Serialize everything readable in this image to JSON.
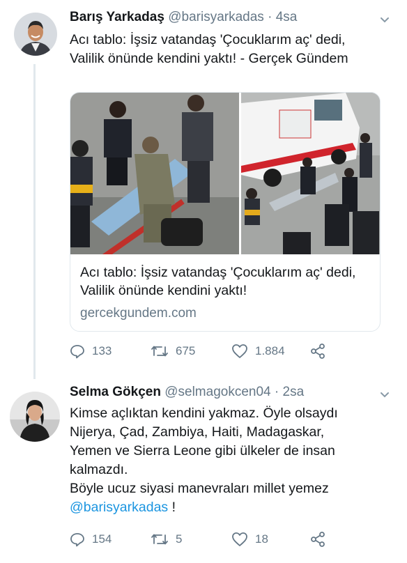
{
  "tweet1": {
    "name": "Barış Yarkadaş",
    "handle": "@barisyarkadas",
    "separator": "·",
    "time": "4sa",
    "text": "Acı tablo: İşsiz vatandaş 'Çocuklarım aç' dedi, Valilik önünde kendini yaktı!   - Gerçek Gündem",
    "card": {
      "title": "Acı tablo: İşsiz vatandaş 'Çocuklarım aç' dedi, Valilik önünde kendini yaktı!",
      "domain": "gercekgundem.com"
    },
    "actions": {
      "replies": "133",
      "retweets": "675",
      "likes": "1.884"
    }
  },
  "tweet2": {
    "name": "Selma Gökçen",
    "handle": "@selmagokcen04",
    "separator": "·",
    "time": "2sa",
    "text_lines": [
      "Kimse açlıktan kendini yakmaz. Öyle olsaydı",
      "Nijerya, Çad, Zambiya, Haiti, Madagaskar,",
      "Yemen ve Sierra Leone gibi ülkeler de insan",
      "kalmazdı.",
      "Böyle ucuz siyasi manevraları millet yemez"
    ],
    "mention": "@barisyarkadas",
    "mention_suffix": " !",
    "actions": {
      "replies": "154",
      "retweets": "5",
      "likes": "18"
    }
  },
  "colors": {
    "link": "#1b95e0",
    "muted": "#657786",
    "text": "#14171a",
    "divider": "#e1e8ed"
  },
  "icons": [
    "reply-icon",
    "retweet-icon",
    "like-icon",
    "share-icon",
    "chevron-down-icon"
  ]
}
